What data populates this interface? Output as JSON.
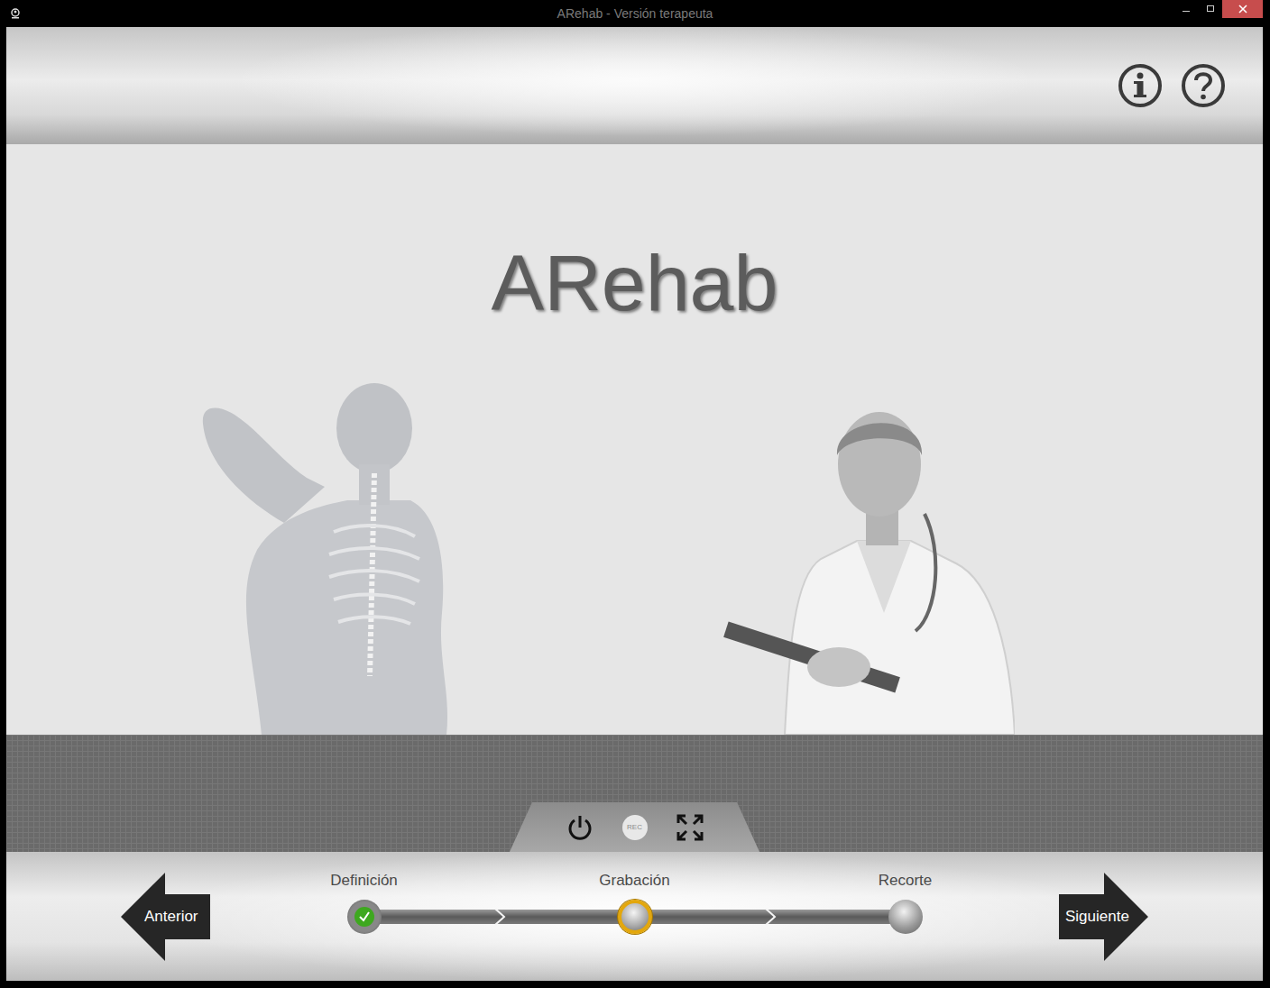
{
  "window": {
    "title": "ARehab - Versión terapeuta"
  },
  "app_title": "ARehab",
  "toolbar": {
    "rec": "REC"
  },
  "nav": {
    "previous": "Anterior",
    "next": "Siguiente"
  },
  "steps": [
    {
      "label": "Definición",
      "completed": true,
      "selected": false
    },
    {
      "label": "Grabación",
      "completed": false,
      "selected": true
    },
    {
      "label": "Recorte",
      "completed": false,
      "selected": false
    }
  ]
}
